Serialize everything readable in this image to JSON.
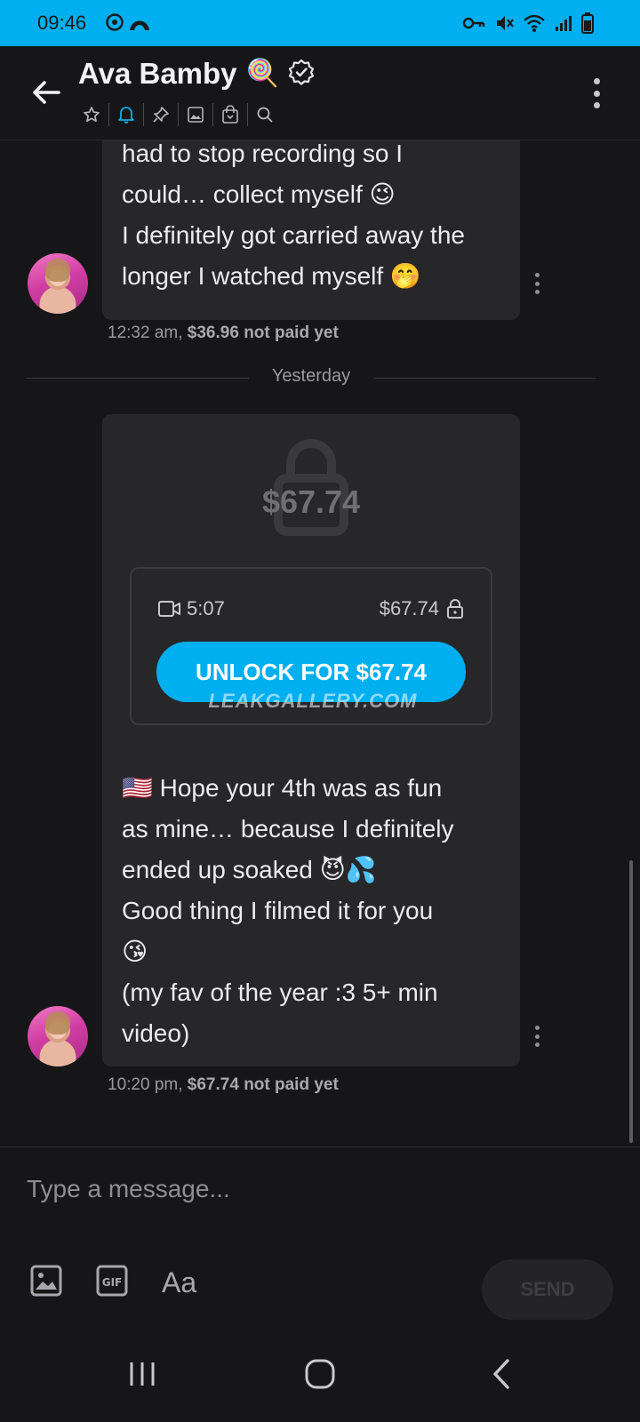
{
  "status_bar": {
    "time": "09:46",
    "icons": [
      "sync-icon",
      "app-icon",
      "key-icon",
      "mute-icon",
      "wifi-icon",
      "signal-icon",
      "battery-icon"
    ]
  },
  "header": {
    "title": "Ava Bamby",
    "title_emoji": "🍭",
    "toolbar_icons": [
      "star-icon",
      "bell-icon",
      "pin-icon",
      "image-icon",
      "shopping-bag-icon",
      "search-icon"
    ],
    "accent": "#00aff0"
  },
  "messages": [
    {
      "text_lines": [
        "had to stop recording so I",
        "could… collect myself 😉",
        "I definitely got carried away the",
        "longer I watched myself 🤭"
      ],
      "time": "12:32 am,",
      "price": "$36.96",
      "status": "not paid yet"
    },
    {
      "locked_price": "$67.74",
      "media_duration": "5:07",
      "media_price": "$67.74",
      "unlock_label": "UNLOCK FOR $67.74",
      "watermark": "LEAKGALLERY.COM",
      "text_lines": [
        "🇺🇸 Hope your 4th was as fun",
        "as mine… because I definitely",
        "ended up soaked 😈💦",
        "Good thing I filmed it for you",
        "😘",
        "(my fav of the year :3 5+ min",
        "video)"
      ],
      "time": "10:20 pm,",
      "price": "$67.74",
      "status": "not paid yet"
    }
  ],
  "date_separator": "Yesterday",
  "composer": {
    "placeholder": "Type a message...",
    "font_label": "Aa",
    "send_label": "SEND"
  },
  "nav": [
    "recent-apps-icon",
    "home-icon",
    "back-icon"
  ]
}
